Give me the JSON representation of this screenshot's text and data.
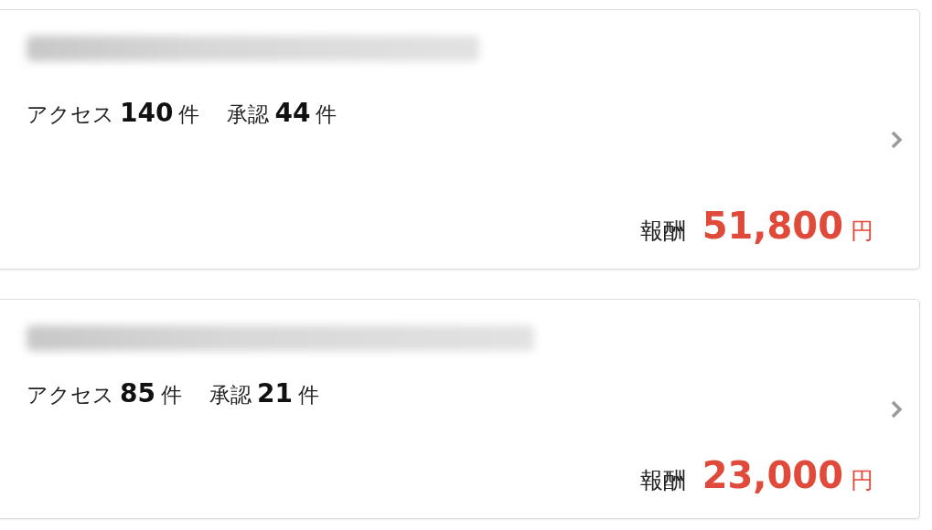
{
  "campaigns": [
    {
      "access_label": "アクセス",
      "access_count": "140",
      "access_unit": "件",
      "approved_label": "承認",
      "approved_count": "44",
      "approved_unit": "件",
      "reward_label": "報酬",
      "reward_amount": "51,800",
      "reward_unit": "円"
    },
    {
      "access_label": "アクセス",
      "access_count": "85",
      "access_unit": "件",
      "approved_label": "承認",
      "approved_count": "21",
      "approved_unit": "件",
      "reward_label": "報酬",
      "reward_amount": "23,000",
      "reward_unit": "円"
    }
  ]
}
